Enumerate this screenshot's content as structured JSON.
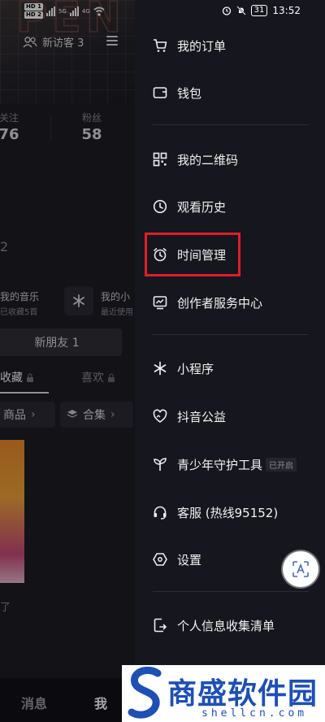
{
  "status_bar": {
    "sim_labels": [
      "HD 1",
      "HD 2"
    ],
    "network": "5G",
    "network2": "4G",
    "battery": "31",
    "time": "13:52"
  },
  "profile_bg": {
    "visitors_label": "新访客 3",
    "following_label": "关注",
    "following_count": "76",
    "followers_label": "粉丝",
    "followers_count": "58",
    "number_fragment": "2",
    "music_title": "我的音乐",
    "music_sub": "已收藏5首",
    "mini_title": "我的小",
    "mini_sub": "最近使用",
    "friends_button": "新朋友 1",
    "tab_collect": "收藏",
    "tab_like": "喜欢",
    "chip_goods": "商品",
    "chip_collection": "合集",
    "text_fragment": "了",
    "nav_messages": "消息",
    "nav_me": "我"
  },
  "drawer": {
    "items": [
      {
        "label": "我的订单",
        "icon": "cart-icon"
      },
      {
        "label": "钱包",
        "icon": "wallet-icon"
      },
      {
        "label": "我的二维码",
        "icon": "qr-code-icon"
      },
      {
        "label": "观看历史",
        "icon": "clock-icon"
      },
      {
        "label": "时间管理",
        "icon": "alarm-clock-icon"
      },
      {
        "label": "创作者服务中心",
        "icon": "chart-monitor-icon"
      },
      {
        "label": "小程序",
        "icon": "asterisk-icon"
      },
      {
        "label": "抖音公益",
        "icon": "heart-hands-icon"
      },
      {
        "label": "青少年守护工具",
        "icon": "sprout-icon",
        "badge": "已开启"
      },
      {
        "label": "客服 (热线95152)",
        "icon": "headset-icon"
      },
      {
        "label": "设置",
        "icon": "hexagon-settings-icon"
      },
      {
        "label": "个人信息收集清单",
        "icon": "document-export-icon"
      }
    ]
  },
  "watermark": {
    "cn": "商盛软件园",
    "en": "shellcn.com"
  },
  "colors": {
    "drawer_bg": "#16161e",
    "highlight": "#e11d2a",
    "watermark_blue": "#1e4fb5"
  }
}
